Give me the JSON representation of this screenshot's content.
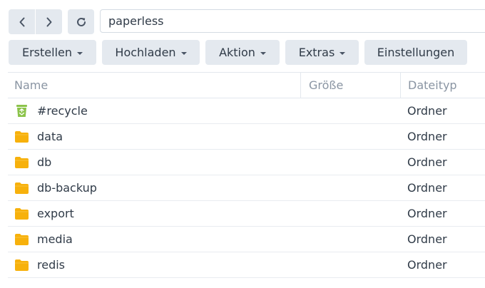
{
  "navigation": {
    "back_icon": "chevron-left-icon",
    "forward_icon": "chevron-right-icon",
    "refresh_icon": "refresh-icon"
  },
  "path": {
    "value": "paperless"
  },
  "toolbar": {
    "create_label": "Erstellen",
    "upload_label": "Hochladen",
    "action_label": "Aktion",
    "extras_label": "Extras",
    "settings_label": "Einstellungen"
  },
  "table": {
    "columns": {
      "name": "Name",
      "size": "Größe",
      "type": "Dateityp"
    },
    "rows": [
      {
        "name": "#recycle",
        "size": "",
        "type": "Ordner",
        "icon": "recycle-bin-icon"
      },
      {
        "name": "data",
        "size": "",
        "type": "Ordner",
        "icon": "folder-icon"
      },
      {
        "name": "db",
        "size": "",
        "type": "Ordner",
        "icon": "folder-icon"
      },
      {
        "name": "db-backup",
        "size": "",
        "type": "Ordner",
        "icon": "folder-icon"
      },
      {
        "name": "export",
        "size": "",
        "type": "Ordner",
        "icon": "folder-icon"
      },
      {
        "name": "media",
        "size": "",
        "type": "Ordner",
        "icon": "folder-icon"
      },
      {
        "name": "redis",
        "size": "",
        "type": "Ordner",
        "icon": "folder-icon"
      }
    ]
  },
  "colors": {
    "button_bg": "#e4e9ef",
    "folder": "#f7b10c",
    "recycle": "#8bc34a",
    "text": "#303b48",
    "header_text": "#8a95a3"
  }
}
